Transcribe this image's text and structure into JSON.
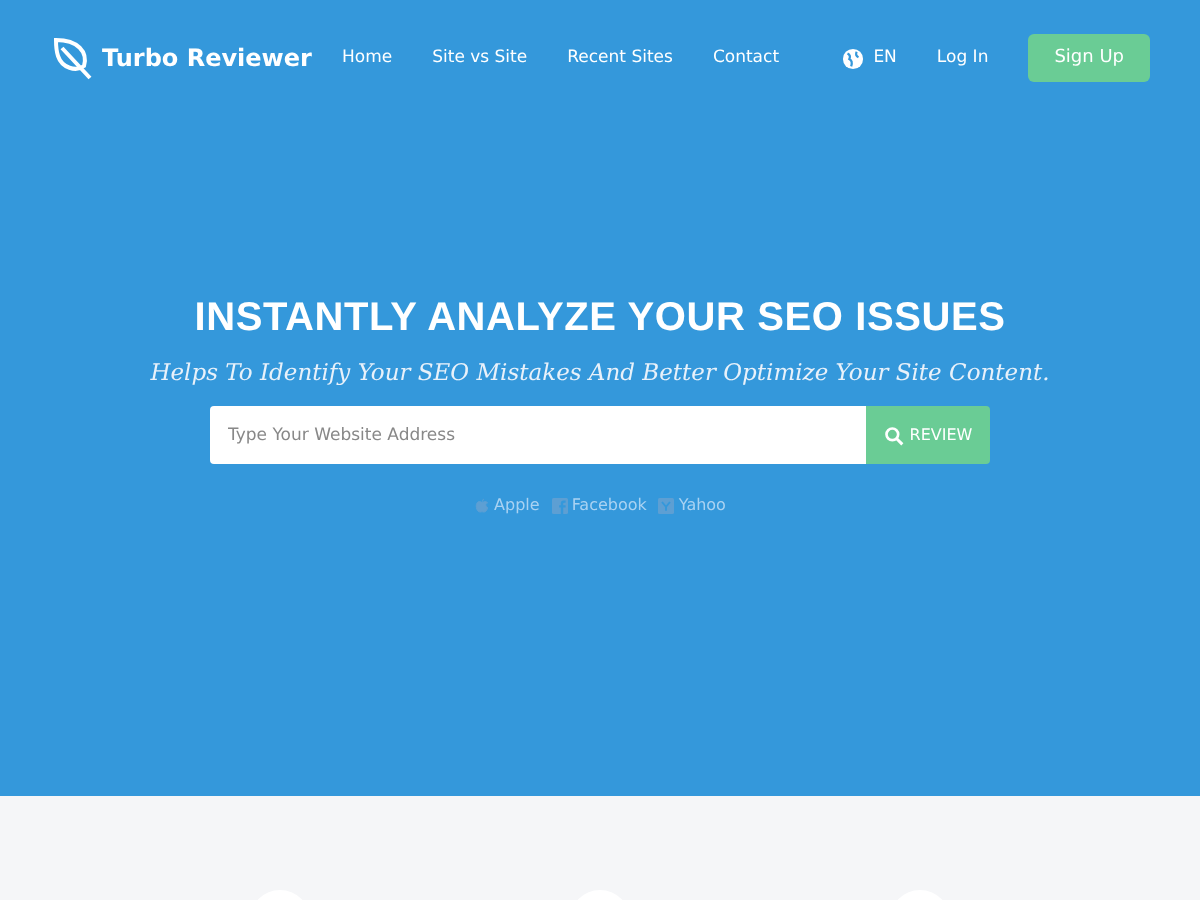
{
  "brand": {
    "name": "Turbo Reviewer"
  },
  "nav": [
    {
      "label": "Home"
    },
    {
      "label": "Site vs Site"
    },
    {
      "label": "Recent Sites"
    },
    {
      "label": "Contact"
    }
  ],
  "language": {
    "label": "EN"
  },
  "login": {
    "label": "Log In"
  },
  "signup": {
    "label": "Sign Up"
  },
  "hero": {
    "title": "INSTANTLY ANALYZE YOUR SEO ISSUES",
    "subtitle": "Helps To Identify Your SEO Mistakes And Better Optimize Your Site Content.",
    "search": {
      "placeholder": "Type Your Website Address"
    },
    "button": "REVIEW",
    "examples": [
      {
        "kind": "apple",
        "label": "Apple"
      },
      {
        "kind": "facebook",
        "label": "Facebook"
      },
      {
        "kind": "yahoo",
        "label": "Yahoo"
      }
    ]
  }
}
